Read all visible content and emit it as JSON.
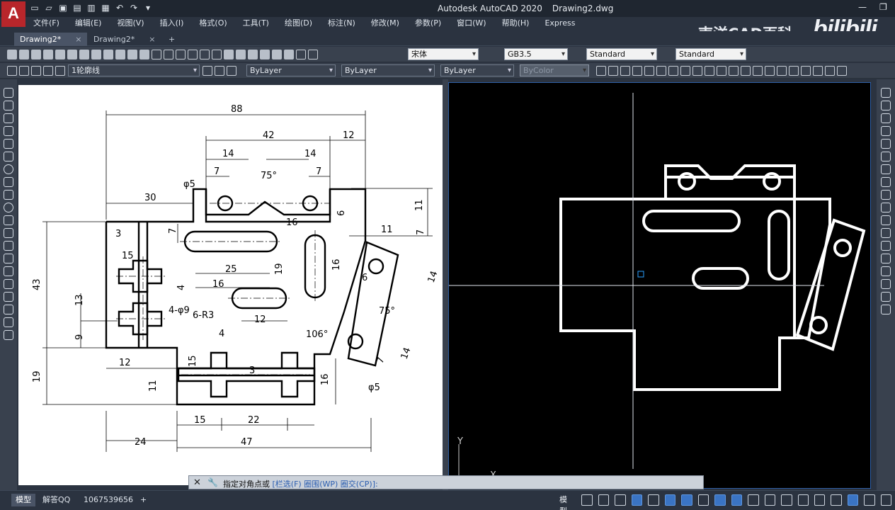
{
  "app": {
    "title": "Autodesk AutoCAD 2020",
    "document": "Drawing2.dwg",
    "logo_letter": "A"
  },
  "menu": [
    "文件(F)",
    "编辑(E)",
    "视图(V)",
    "插入(I)",
    "格式(O)",
    "工具(T)",
    "绘图(D)",
    "标注(N)",
    "修改(M)",
    "参数(P)",
    "窗口(W)",
    "帮助(H)",
    "Express"
  ],
  "watermark": {
    "text": "南洋CAD百科",
    "brand": "bilibili"
  },
  "file_tabs": [
    {
      "label": "Drawing2*",
      "close": "×"
    },
    {
      "label": "Drawing2*",
      "close": "×"
    },
    {
      "label": "+"
    }
  ],
  "toolbar_styles": {
    "text_font": "宋体",
    "dim_style": "GB3.5",
    "table_style": "Standard",
    "multileader_style": "Standard"
  },
  "toolbar_layers": {
    "layer": "1轮廓线",
    "color": "ByLayer",
    "linetype": "ByLayer",
    "lineweight": "ByLayer",
    "plot_style": "ByColor"
  },
  "drawing_dims": {
    "top_88": "88",
    "d42": "42",
    "d12a": "12",
    "d14a": "14",
    "d14b": "14",
    "d7a": "7",
    "d7b": "7",
    "ang75a": "75°",
    "phi5a": "φ5",
    "d30": "30",
    "d11a": "11",
    "d6a": "6",
    "d16a": "16",
    "d7c": "7",
    "d3": "3",
    "d15a": "15",
    "d11b": "11",
    "d7d": "7",
    "d43": "43",
    "d25": "25",
    "d19a": "19",
    "d16b": "16",
    "d16c": "16",
    "d4a": "4",
    "d13": "13",
    "d4phi9": "4-φ9",
    "d6r3": "6-R3",
    "d6b": "6",
    "d12b": "12",
    "d14c": "14",
    "ang75b": "75°",
    "d9": "9",
    "d4b": "4",
    "ang106": "106°",
    "d12c": "12",
    "d15b": "15",
    "d3b": "3",
    "d19b": "19",
    "d11c": "11",
    "d16d": "16",
    "d7e": "7",
    "d14d": "14",
    "phi5b": "φ5",
    "d15c": "15",
    "d22": "22",
    "d24": "24",
    "d47": "47"
  },
  "ucs": {
    "y_label": "Y",
    "x_label": "X"
  },
  "command_line": {
    "close": "✕",
    "wrench": "🔧",
    "prompt": "指定对角点或",
    "opt1": "[栏选(F)",
    "opt2": "圈围(WP)",
    "opt3": "圈交(CP)]:"
  },
  "status": {
    "tabs": [
      "模型",
      "解答QQ",
      "1067539656",
      "+"
    ],
    "model_label": "模型"
  },
  "colors": {
    "accent": "#2f5fa6",
    "logo_red": "#b8262b",
    "canvas_dark": "#000000",
    "canvas_light": "#ffffff"
  }
}
